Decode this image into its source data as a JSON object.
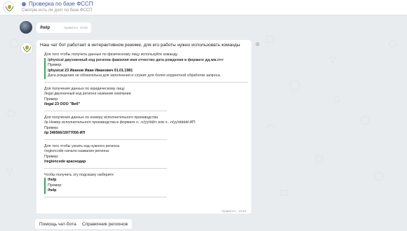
{
  "header": {
    "title": "Проверка по базе ФССП",
    "subtitle": "Смотрю есть ли долг по базе ФССП",
    "verified_icon": "verified-badge-icon",
    "accent_color": "#6c7ad2"
  },
  "user_message": {
    "text": "/help",
    "status": "Нравится",
    "time": "10:52"
  },
  "bot_message": {
    "intro": "Наш чат бот работает в интерактивном режиме, для его работы нужно использовать команды",
    "blocks": [
      {
        "lines": [
          "Для того чтобы получить данные по физическому лицу используйте команду",
          "/physical двухначный код региона фамилия имя отчество дата рождения в формате дд.мм.гггг",
          "Пример:",
          "/physical 23 Иванов Иван Иванович 01.01.1981",
          "Дата рождения не обязательна для заполнения и служит для более корректной обработки запроса."
        ]
      },
      {
        "lines": [
          "Для получения данных по юридическому лицу",
          "/legal двухначный код региона название компании",
          "Пример:",
          "/legal 23 ООО \"Веб\""
        ]
      },
      {
        "lines": [
          "Для получения данных по номеру исполнительного производства",
          "/ip Номер исполнительного производства в формате n...n/yy/dd/rr или n...n/yy/ddddd-ИП",
          "Пример:",
          "/ip 346566/19/77056-ИП"
        ]
      },
      {
        "lines": [
          "Для того чтобы узнать код нужного региона",
          "/regioncode начало названия региона",
          "Пример:",
          "/regioncode краснодар"
        ]
      },
      {
        "lines": [
          "Чтобы получить эту подсказку наберите",
          "/help",
          "Пример:",
          "/help"
        ]
      }
    ],
    "status": "Нравится",
    "time": "10:52"
  },
  "keyboard": {
    "buttons": [
      "Помощь чат-бота",
      "Справочник регионов"
    ]
  }
}
